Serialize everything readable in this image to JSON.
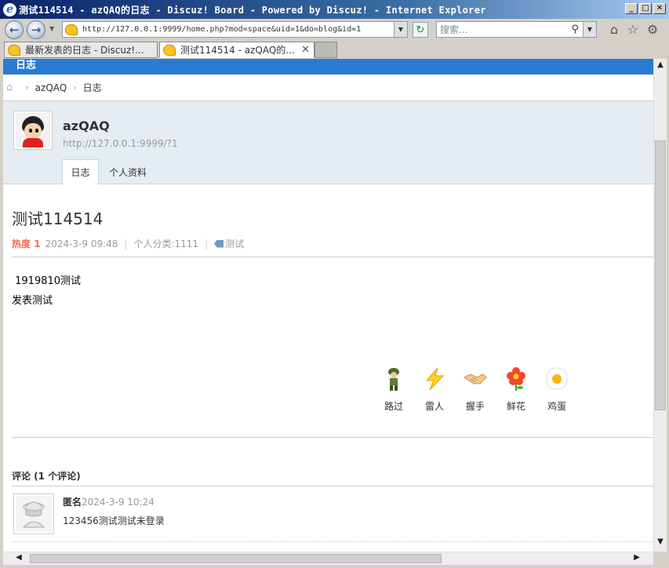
{
  "window": {
    "title": "测试114514 - azQAQ的日志 - Discuz! Board - Powered by Discuz! - Internet Explorer",
    "url": "http://127.0.0.1:9999/home.php?mod=space&uid=1&do=blog&id=1",
    "search_placeholder": "搜索..."
  },
  "tabs": [
    {
      "label": "最新发表的日志 - Discuz!..."
    },
    {
      "label": "测试114514 - azQAQ的..."
    }
  ],
  "page": {
    "header_label": "日志",
    "breadcrumb": [
      "azQAQ",
      "日志"
    ],
    "profile": {
      "username": "azQAQ",
      "space_url": "http://127.0.0.1:9999/?1",
      "tabs": [
        "日志",
        "个人资料"
      ]
    },
    "post": {
      "title": "测试114514",
      "heat_label": "热度",
      "heat_value": "1",
      "date": "2024-3-9 09:48",
      "category": "个人分类:1111",
      "tag": "测试",
      "content": [
        " 1919810测试",
        "发表测试"
      ]
    },
    "reactions": [
      {
        "label": "路过",
        "icon": "soldier-icon"
      },
      {
        "label": "雷人",
        "icon": "lightning-icon"
      },
      {
        "label": "握手",
        "icon": "handshake-icon"
      },
      {
        "label": "鲜花",
        "icon": "flower-icon"
      },
      {
        "label": "鸡蛋",
        "icon": "egg-icon"
      }
    ],
    "comments": {
      "title": "评论 (1 个评论)",
      "items": [
        {
          "author": "匿名",
          "time": "2024-3-9 10:24",
          "text": "123456测试测试未登录"
        }
      ]
    }
  }
}
